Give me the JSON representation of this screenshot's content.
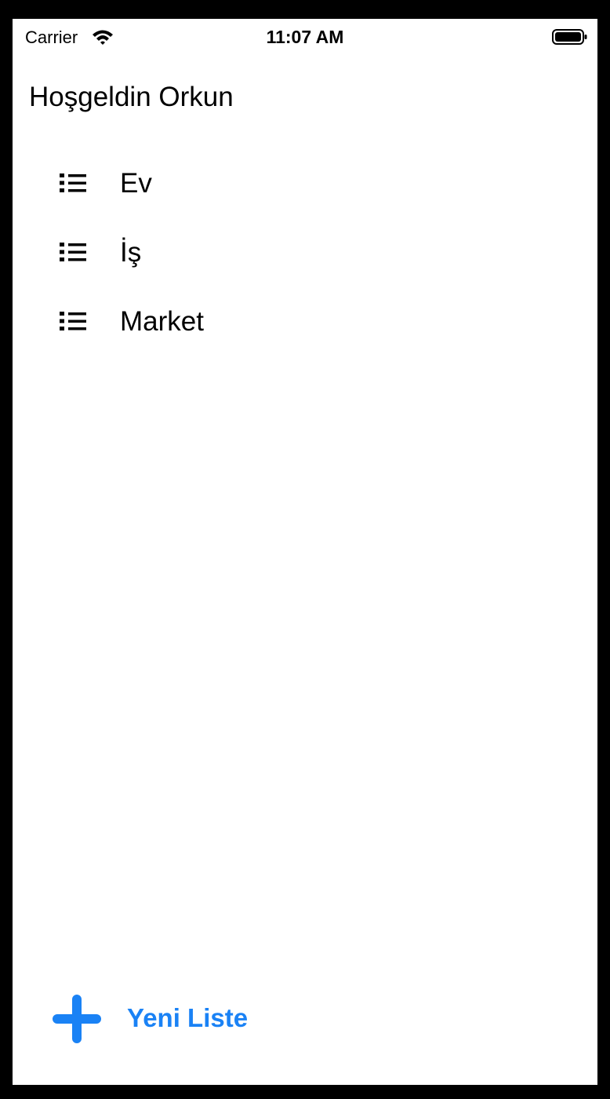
{
  "status_bar": {
    "carrier": "Carrier",
    "time": "11:07 AM",
    "wifi_icon": "wifi-icon",
    "battery_icon": "battery-icon"
  },
  "greeting": "Hoşgeldin Orkun",
  "lists": [
    {
      "label": "Ev",
      "icon": "list-bullet-icon"
    },
    {
      "label": "İş",
      "icon": "list-bullet-icon"
    },
    {
      "label": "Market",
      "icon": "list-bullet-icon"
    }
  ],
  "new_list_button": {
    "label": "Yeni Liste",
    "icon": "plus-icon",
    "color": "#1a82f5"
  }
}
